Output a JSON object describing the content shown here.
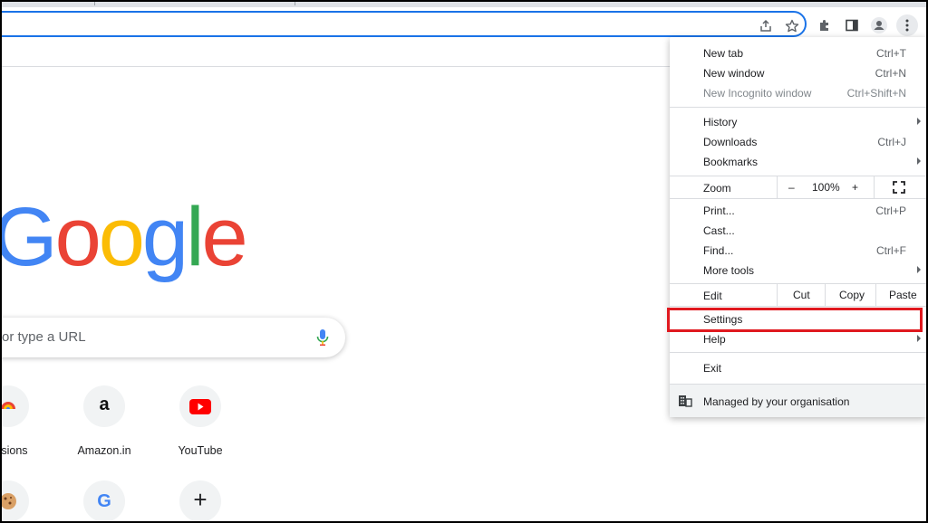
{
  "colors": {
    "accent": "#1a73e8",
    "highlight": "#e0191f",
    "g_blue": "#4285f4",
    "g_red": "#ea4335",
    "g_yellow": "#fbbc05",
    "g_green": "#34a853"
  },
  "toolbar": {
    "icons": [
      "share-icon",
      "star-icon",
      "extensions-icon",
      "side-panel-icon",
      "profile-icon",
      "menu-kebab-icon"
    ]
  },
  "ntp": {
    "logo": [
      "G",
      "o",
      "o",
      "g",
      "l",
      "e"
    ],
    "search_placeholder": "or type a URL",
    "shortcuts_row1": [
      {
        "label": "ensions"
      },
      {
        "label": "Amazon.in",
        "glyph": "a"
      },
      {
        "label": "YouTube"
      }
    ],
    "shortcuts_row2": [
      {
        "label": ""
      },
      {
        "label": "",
        "glyph": "G"
      },
      {
        "label": "",
        "glyph": "+"
      }
    ]
  },
  "menu": {
    "new_tab": {
      "label": "New tab",
      "shortcut": "Ctrl+T"
    },
    "new_window": {
      "label": "New window",
      "shortcut": "Ctrl+N"
    },
    "new_incognito": {
      "label": "New Incognito window",
      "shortcut": "Ctrl+Shift+N"
    },
    "history": {
      "label": "History"
    },
    "downloads": {
      "label": "Downloads",
      "shortcut": "Ctrl+J"
    },
    "bookmarks": {
      "label": "Bookmarks"
    },
    "zoom": {
      "label": "Zoom",
      "minus": "–",
      "value": "100%",
      "plus": "+"
    },
    "print": {
      "label": "Print...",
      "shortcut": "Ctrl+P"
    },
    "cast": {
      "label": "Cast..."
    },
    "find": {
      "label": "Find...",
      "shortcut": "Ctrl+F"
    },
    "more_tools": {
      "label": "More tools"
    },
    "edit": {
      "label": "Edit",
      "cut": "Cut",
      "copy": "Copy",
      "paste": "Paste"
    },
    "settings": {
      "label": "Settings"
    },
    "help": {
      "label": "Help"
    },
    "exit": {
      "label": "Exit"
    },
    "managed": {
      "label": "Managed by your organisation"
    }
  }
}
